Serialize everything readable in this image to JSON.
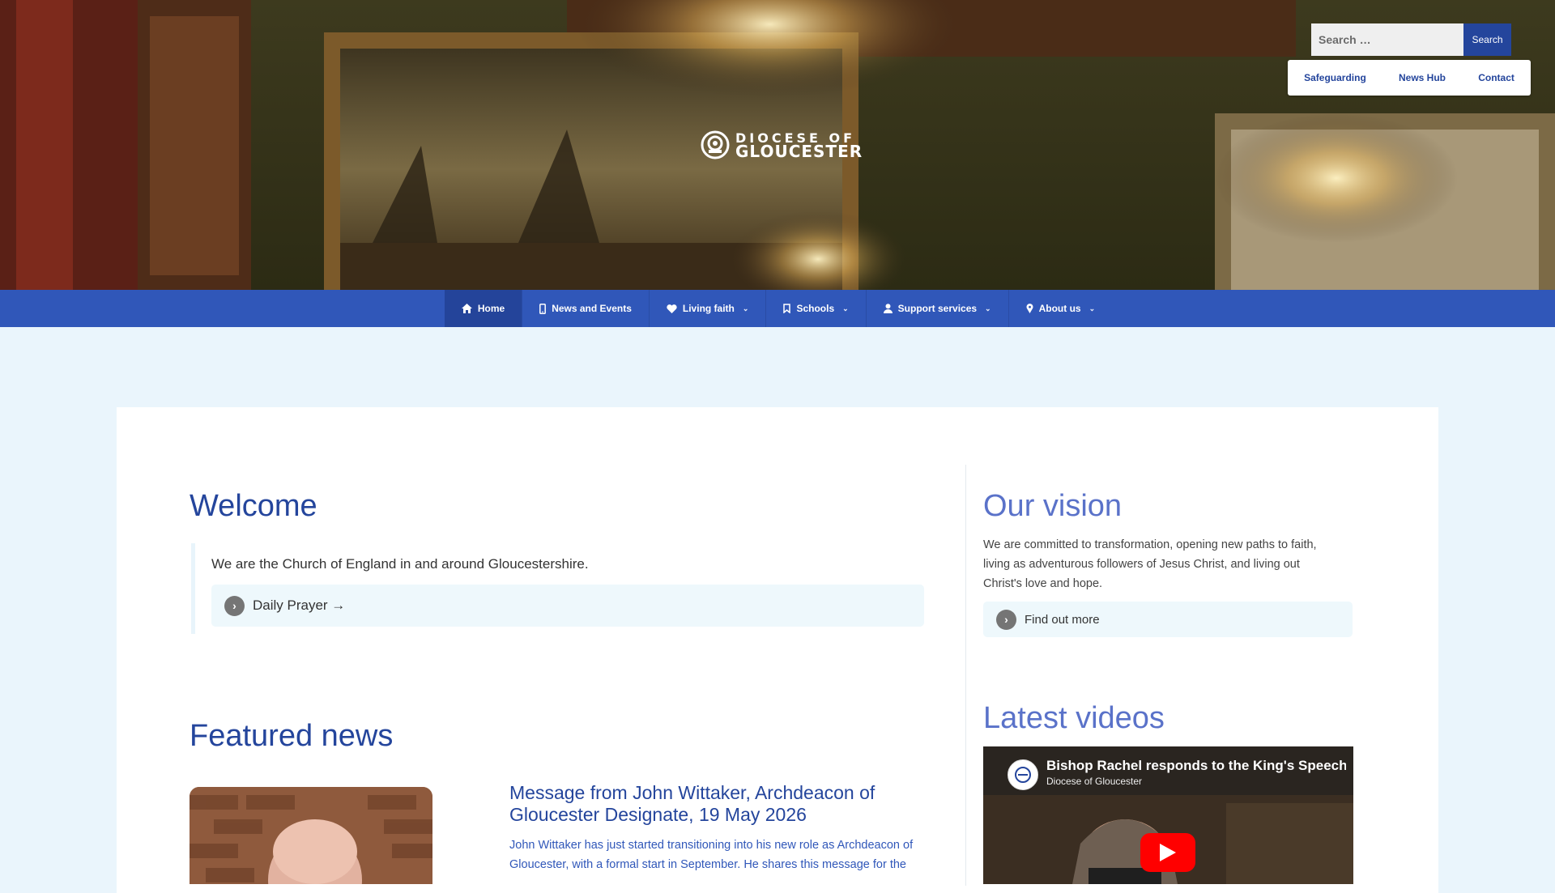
{
  "search": {
    "placeholder": "Search …",
    "button_label": "Search"
  },
  "utility_links": [
    "Safeguarding",
    "News Hub",
    "Contact"
  ],
  "logo": {
    "line1": "DIOCESE OF",
    "line2": "GLOUCESTER"
  },
  "nav": {
    "items": [
      {
        "label": "Home",
        "icon": "home-icon",
        "active": true,
        "dropdown": false
      },
      {
        "label": "News and Events",
        "icon": "mobile-icon",
        "active": false,
        "dropdown": false
      },
      {
        "label": "Living faith",
        "icon": "heart-icon",
        "active": false,
        "dropdown": true
      },
      {
        "label": "Schools",
        "icon": "bookmark-icon",
        "active": false,
        "dropdown": true
      },
      {
        "label": "Support services",
        "icon": "user-icon",
        "active": false,
        "dropdown": true
      },
      {
        "label": "About us",
        "icon": "map-pin-icon",
        "active": false,
        "dropdown": true
      }
    ]
  },
  "welcome": {
    "title": "Welcome",
    "text": "We are the Church of England in and around Gloucestershire.",
    "link_label": "Daily Prayer →"
  },
  "featured": {
    "title": "Featured news",
    "news_title": "Message from John Wittaker, Archdeacon of Gloucester Designate, 19 May 2026",
    "news_excerpt": "John Wittaker has just started transitioning into his new role as Archdeacon of Gloucester, with a formal start in September. He shares this message for the"
  },
  "vision": {
    "title": "Our vision",
    "text": "We are committed to transformation, opening new paths to faith, living as adventurous followers of Jesus Christ, and living out Christ's love and hope.",
    "link_label": "Find out more"
  },
  "videos": {
    "title": "Latest videos",
    "video_title": "Bishop Rachel responds to the King's Speech",
    "channel": "Diocese of Gloucester"
  },
  "colors": {
    "brand_blue": "#24459c",
    "nav_blue": "#3057b9",
    "accent_blue": "#5a72c9",
    "page_bg": "#eaf5fc"
  }
}
